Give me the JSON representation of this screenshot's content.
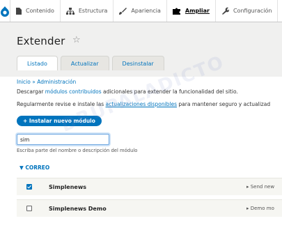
{
  "toolbar": {
    "home_icon": "drupal-drop-icon",
    "items": [
      {
        "label": "Contenido",
        "icon": "file-icon"
      },
      {
        "label": "Estructura",
        "icon": "sitemap-icon"
      },
      {
        "label": "Apariencia",
        "icon": "paintbrush-icon"
      },
      {
        "label": "Ampliar",
        "icon": "puzzle-icon"
      },
      {
        "label": "Configuración",
        "icon": "wrench-icon"
      }
    ]
  },
  "page": {
    "title": "Extender",
    "star": "☆"
  },
  "tabs": [
    "Listado",
    "Actualizar",
    "Desinstalar"
  ],
  "breadcrumb": {
    "home": "Inicio",
    "sep": " » ",
    "admin": "Administración"
  },
  "description": {
    "line1_pre": "Descargar ",
    "line1_link": "módulos contribuidos",
    "line1_post": " adicionales para extender la funcionalidad del sitio.",
    "line2_pre": "Regularmente revise e instale las ",
    "line2_link": "actualizaciones disponibles",
    "line2_post": " para mantener seguro y actualizad"
  },
  "install_button": "+ Instalar nuevo módulo",
  "filter": {
    "value": "sim",
    "help": "Escriba parte del nombre o descripción del módulo"
  },
  "group": {
    "label": "▼ CORREO"
  },
  "modules": [
    {
      "name": "Simplenews",
      "desc": "▸ Send new",
      "checked": true
    },
    {
      "name": "Simplenews Demo",
      "desc": "▸ Demo mo",
      "checked": false
    }
  ],
  "watermark": "DRUPALADICTO"
}
